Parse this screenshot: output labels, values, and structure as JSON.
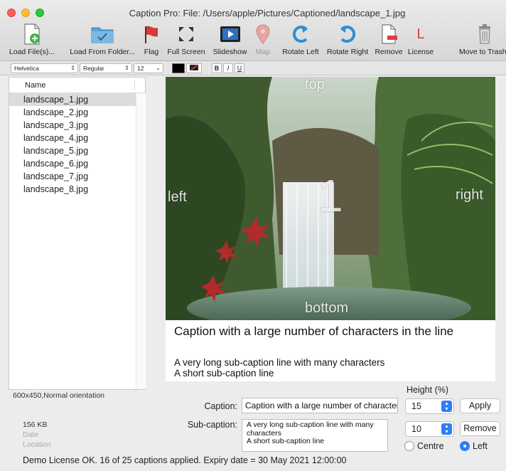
{
  "window": {
    "title": "Caption Pro: File: /Users/apple/Pictures/Captioned/landscape_1.jpg"
  },
  "toolbar": {
    "load_files": "Load File(s)...",
    "load_folder": "Load From Folder...",
    "flag": "Flag",
    "full_screen": "Full Screen",
    "slideshow": "Slideshow",
    "map": "Map",
    "rotate_left": "Rotate Left",
    "rotate_right": "Rotate Right",
    "remove": "Remove",
    "license": "License",
    "license_glyph": "L",
    "trash": "Move to Trash"
  },
  "format_bar": {
    "font": "Helvetica",
    "style": "Regular",
    "size": "12",
    "bold": "B",
    "italic": "I",
    "underline": "U",
    "text_color": "#000000"
  },
  "file_list": {
    "header": "Name",
    "items": [
      "landscape_1.jpg",
      "landscape_2.jpg",
      "landscape_3.jpg",
      "landscape_4.jpg",
      "landscape_5.jpg",
      "landscape_6.jpg",
      "landscape_7.jpg",
      "landscape_8.jpg"
    ],
    "selected_index": 0
  },
  "preview": {
    "overlay_top": "top",
    "overlay_left": "left",
    "overlay_right": "right",
    "overlay_bottom": "bottom",
    "overlay_number": "1",
    "caption": "Caption with a large number of characters in the line",
    "subcaption_line1": "A very long sub-caption line with many characters",
    "subcaption_line2": "A short sub-caption line"
  },
  "info": {
    "dimensions": "600x450,Normal orientation",
    "file_size": "156 KB",
    "date_label": "Date",
    "location_label": "Location"
  },
  "editor": {
    "caption_label": "Caption:",
    "caption_value": "Caption with a large number of characters in the line",
    "subcaption_label": "Sub-caption:",
    "subcaption_line1": "A very long sub-caption line with many",
    "subcaption_line2": "characters",
    "subcaption_line3": "A short sub-caption line",
    "height_label": "Height (%)",
    "caption_height": "15",
    "subcaption_height": "10",
    "apply_button": "Apply",
    "remove_button": "Remove",
    "align_centre": "Centre",
    "align_left": "Left",
    "align_selected": "left"
  },
  "status": {
    "text": "Demo License OK. 16 of 25 captions applied.  Expiry date = 30 May 2021 12:00:00"
  },
  "colors": {
    "accent": "#2f7df6",
    "flag": "#d63a3a",
    "remove": "#e23b3b",
    "folder": "#5aa2d6"
  }
}
